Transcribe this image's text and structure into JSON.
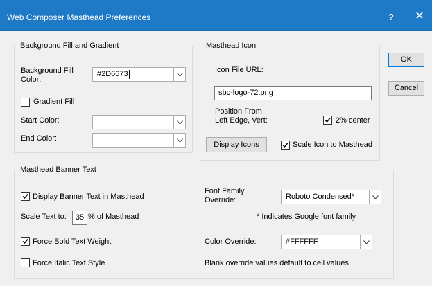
{
  "window": {
    "title": "Web Composer Masthead Preferences",
    "help_glyph": "?",
    "close_glyph": "✕"
  },
  "buttons": {
    "ok": "OK",
    "cancel": "Cancel"
  },
  "background_group": {
    "legend": "Background Fill and Gradient",
    "fill_color_label_line1": "Background Fill",
    "fill_color_label_line2": "Color:",
    "fill_color_value": "#2D6673",
    "gradient_fill_label": "Gradient Fill",
    "gradient_fill_checked": false,
    "start_color_label": "Start Color:",
    "start_color_value": "",
    "end_color_label": "End Color:",
    "end_color_value": ""
  },
  "icon_group": {
    "legend": "Masthead Icon",
    "icon_url_label": "Icon File URL:",
    "icon_url_value": "sbc-logo-72.png",
    "position_label_line1": "Position From",
    "position_label_line2": "Left Edge, Vert:",
    "center_label": "2% center",
    "center_checked": true,
    "display_icons_button": "Display Icons",
    "scale_icon_label": "Scale Icon to Masthead",
    "scale_icon_checked": true
  },
  "banner_group": {
    "legend": "Masthead Banner Text",
    "display_banner_label": "Display Banner Text in Masthead",
    "display_banner_checked": true,
    "scale_text_label": "Scale Text to:",
    "scale_text_value": "35",
    "scale_text_suffix": "% of Masthead",
    "force_bold_label": "Force Bold Text Weight",
    "force_bold_checked": true,
    "force_italic_label": "Force Italic Text Style",
    "force_italic_checked": false,
    "font_family_label_line1": "Font Family",
    "font_family_label_line2": "Override:",
    "font_family_value": "Roboto Condensed*",
    "google_font_note": "* Indicates Google font family",
    "color_override_label": "Color Override:",
    "color_override_value": "#FFFFFF",
    "blank_override_note": "Blank override values default to cell values"
  },
  "colors": {
    "titlebar": "#1E7AC6",
    "default_button_border": "#0078D7"
  },
  "icons": {
    "check": "check-icon",
    "dropdown": "chevron-down-icon",
    "close": "close-icon",
    "help": "help-icon"
  }
}
